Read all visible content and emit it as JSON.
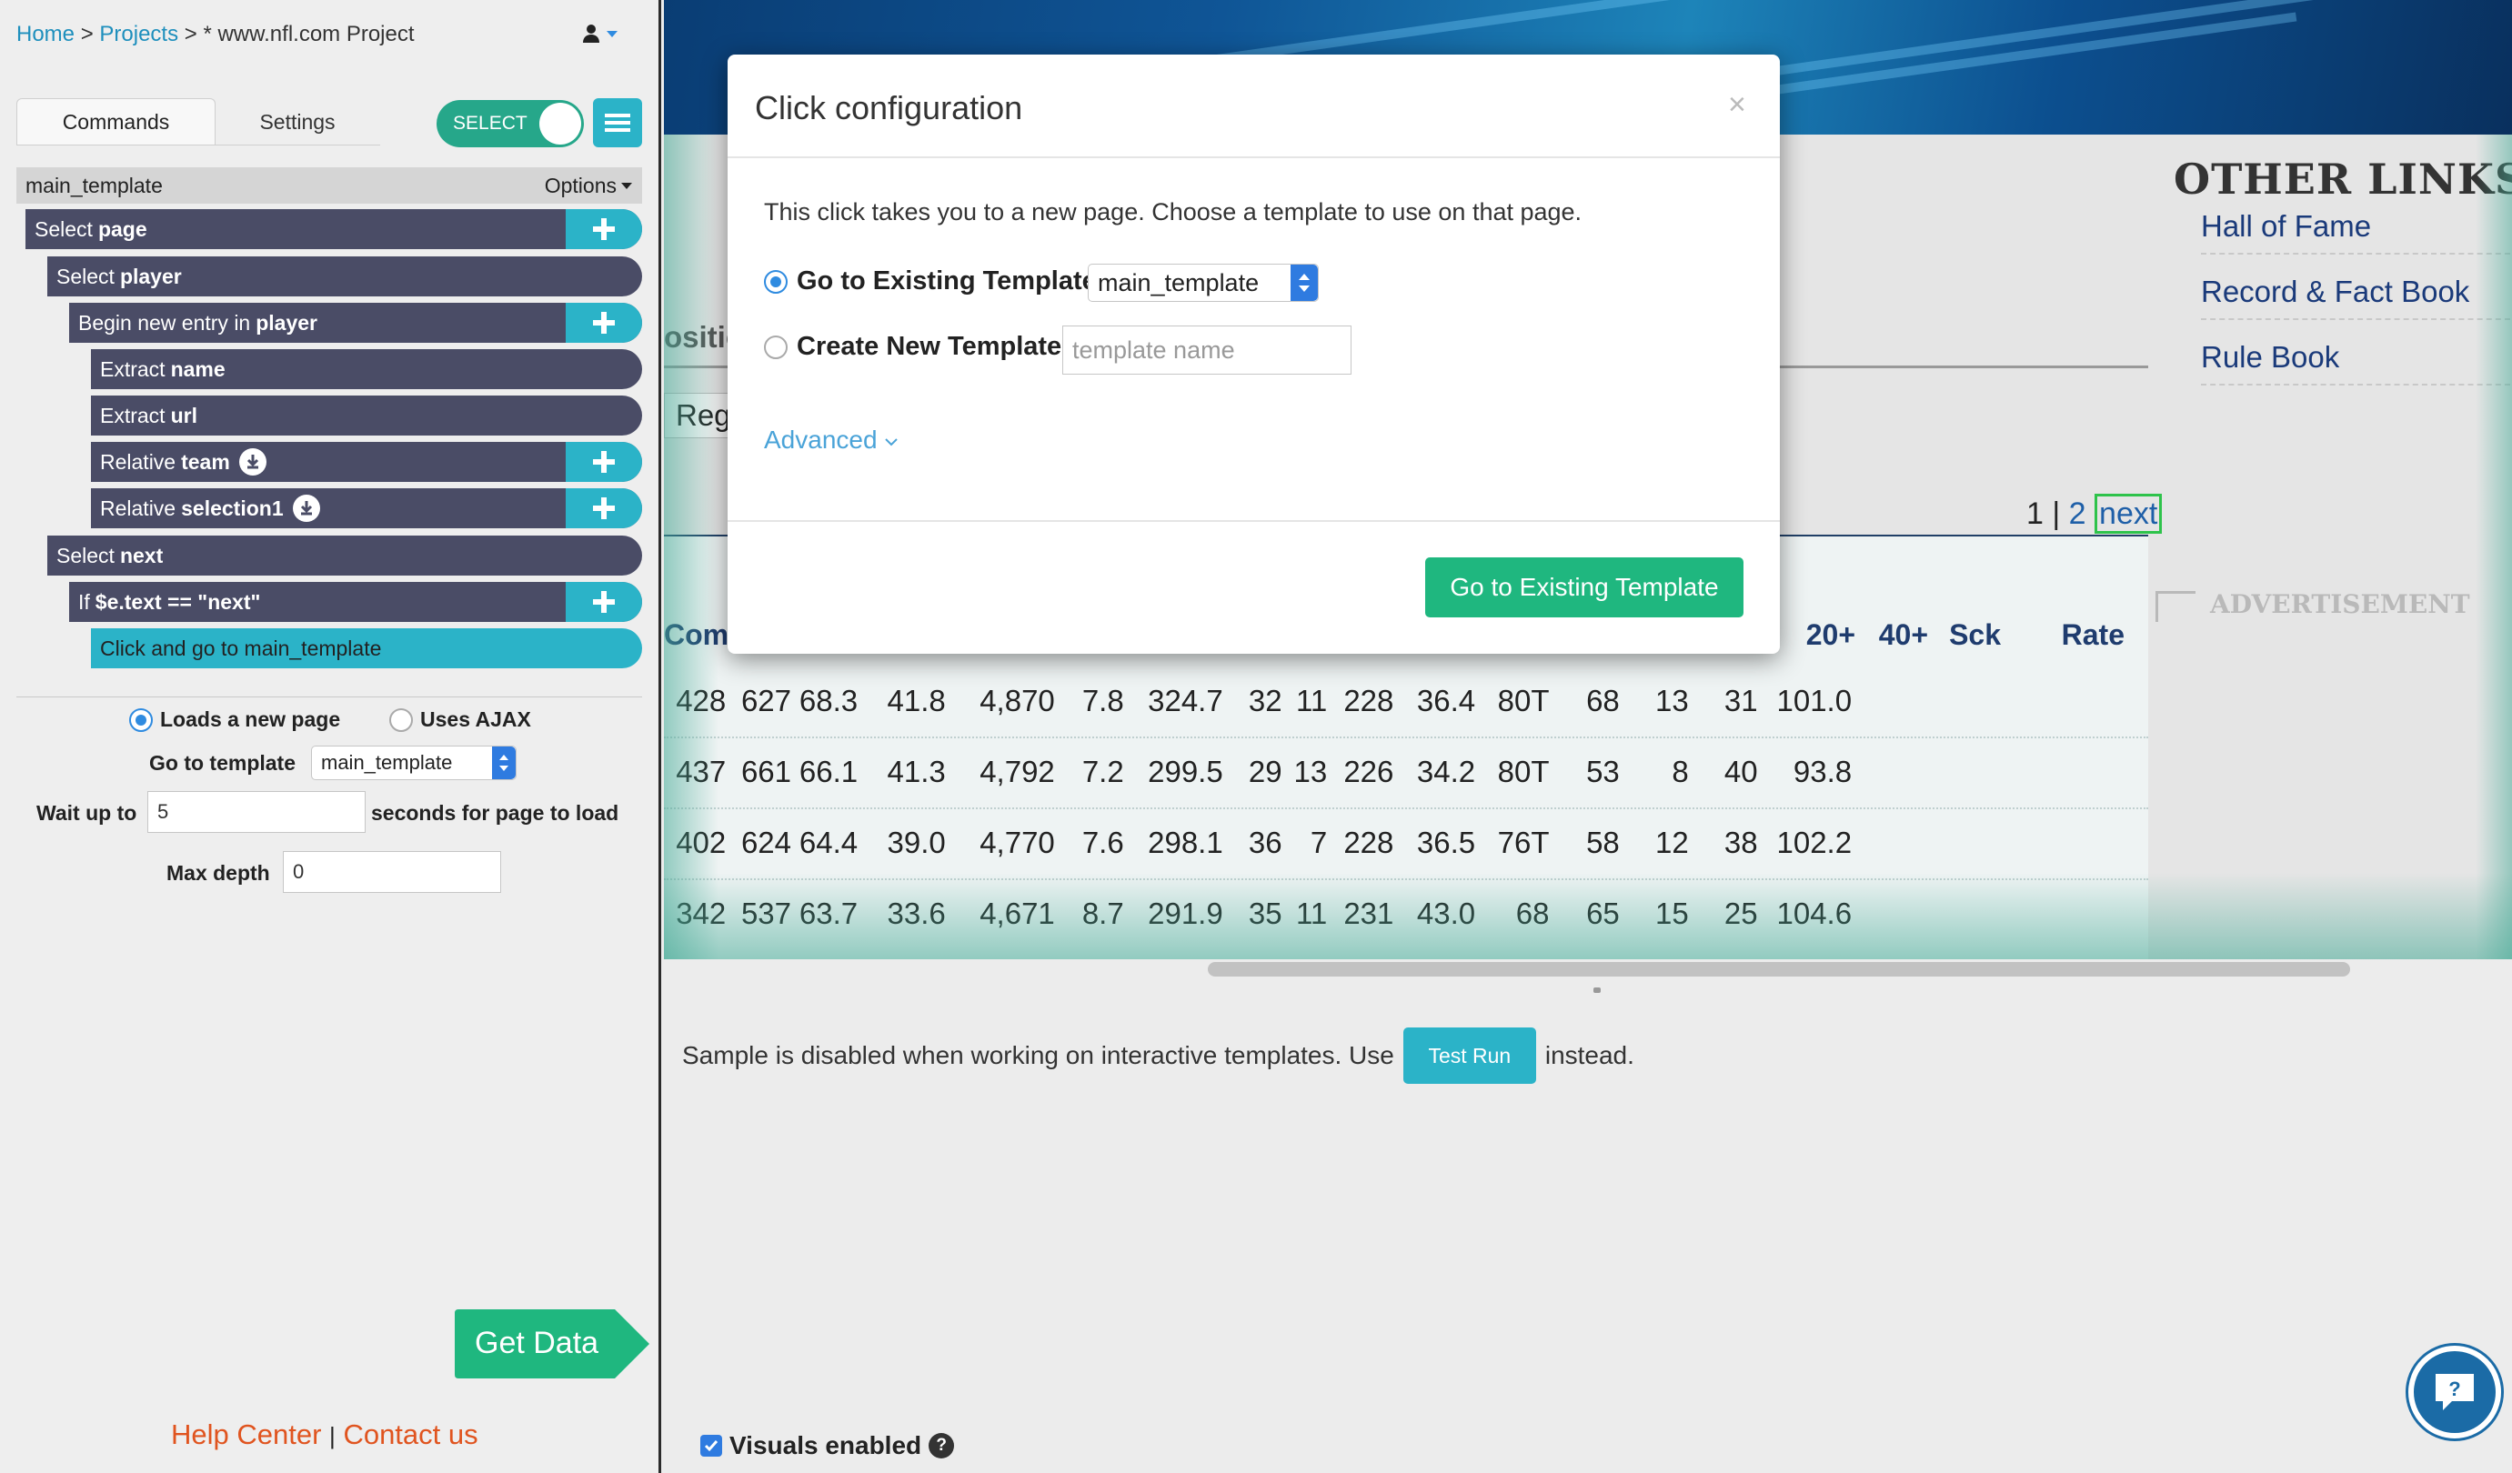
{
  "breadcrumb": {
    "home": "Home",
    "sep1": ">",
    "projects": "Projects",
    "sep2": ">",
    "project": "* www.nfl.com Project"
  },
  "tabs": {
    "commands": "Commands",
    "settings": "Settings"
  },
  "toggle": {
    "label": "SELECT"
  },
  "template_bar": {
    "name": "main_template",
    "options": "Options"
  },
  "commands": [
    {
      "prefix": "Select",
      "bold": "page",
      "plus": true,
      "download": false
    },
    {
      "prefix": "Select",
      "bold": "player",
      "plus": false,
      "download": false
    },
    {
      "prefix": "Begin new entry in",
      "bold": "player",
      "plus": true,
      "download": false
    },
    {
      "prefix": "Extract",
      "bold": "name",
      "plus": false,
      "download": false
    },
    {
      "prefix": "Extract",
      "bold": "url",
      "plus": false,
      "download": false
    },
    {
      "prefix": "Relative",
      "bold": "team",
      "plus": true,
      "download": true
    },
    {
      "prefix": "Relative",
      "bold": "selection1",
      "plus": true,
      "download": true
    },
    {
      "prefix": "Select",
      "bold": "next",
      "plus": false,
      "download": false
    },
    {
      "prefix": "If",
      "bold": "$e.text == \"next\"",
      "plus": true,
      "download": false
    },
    {
      "prefix": "Click and go to main_template",
      "bold": "",
      "plus": false,
      "download": false
    }
  ],
  "click_settings": {
    "loads_new_page": "Loads a new page",
    "uses_ajax": "Uses AJAX",
    "go_to_template_label": "Go to template",
    "go_to_template_value": "main_template",
    "wait_label": "Wait up to",
    "wait_value": "5",
    "wait_suffix": "seconds for page to load",
    "max_depth_label": "Max depth",
    "max_depth_value": "0"
  },
  "get_data": "Get Data",
  "footer": {
    "help": "Help Center",
    "sep": "|",
    "contact": "Contact us"
  },
  "webpage": {
    "other_links_title": "OTHER LINKS",
    "links": [
      "Hall of Fame",
      "Record & Fact Book",
      "Rule Book"
    ],
    "advertisement": "ADVERTISEMENT",
    "position_partial": "ositio",
    "reg_partial": "Reg",
    "pager": {
      "p1": "1",
      "sep": "|",
      "p2": "2",
      "next": "next"
    },
    "columns": [
      "Comp",
      "20+",
      "40+",
      "Sck",
      "Rate"
    ],
    "rows": [
      [
        "428",
        "627",
        "68.3",
        "41.8",
        "4,870",
        "7.8",
        "324.7",
        "32",
        "11",
        "228",
        "36.4",
        "80T",
        "68",
        "13",
        "31",
        "101.0"
      ],
      [
        "437",
        "661",
        "66.1",
        "41.3",
        "4,792",
        "7.2",
        "299.5",
        "29",
        "13",
        "226",
        "34.2",
        "80T",
        "53",
        "8",
        "40",
        "93.8"
      ],
      [
        "402",
        "624",
        "64.4",
        "39.0",
        "4,770",
        "7.6",
        "298.1",
        "36",
        "7",
        "228",
        "36.5",
        "76T",
        "58",
        "12",
        "38",
        "102.2"
      ],
      [
        "342",
        "537",
        "63.7",
        "33.6",
        "4,671",
        "8.7",
        "291.9",
        "35",
        "11",
        "231",
        "43.0",
        "68",
        "65",
        "15",
        "25",
        "104.6"
      ]
    ]
  },
  "sample": {
    "before": "Sample is disabled when working on interactive templates. Use",
    "button": "Test Run",
    "after": "instead."
  },
  "visuals": {
    "label": "Visuals enabled",
    "checked": true
  },
  "modal": {
    "title": "Click configuration",
    "close": "×",
    "description": "This click takes you to a new page. Choose a template to use on that page.",
    "option_existing": "Go to Existing Template",
    "existing_value": "main_template",
    "option_new": "Create New Template",
    "new_placeholder": "template name",
    "advanced": "Advanced",
    "primary_button": "Go to Existing Template"
  },
  "colors": {
    "teal": "#2bb3c8",
    "green": "#1fb77f",
    "cmd_bg": "#4a4c66",
    "link_blue": "#1e8fbd",
    "footer_red": "#e0541f"
  }
}
